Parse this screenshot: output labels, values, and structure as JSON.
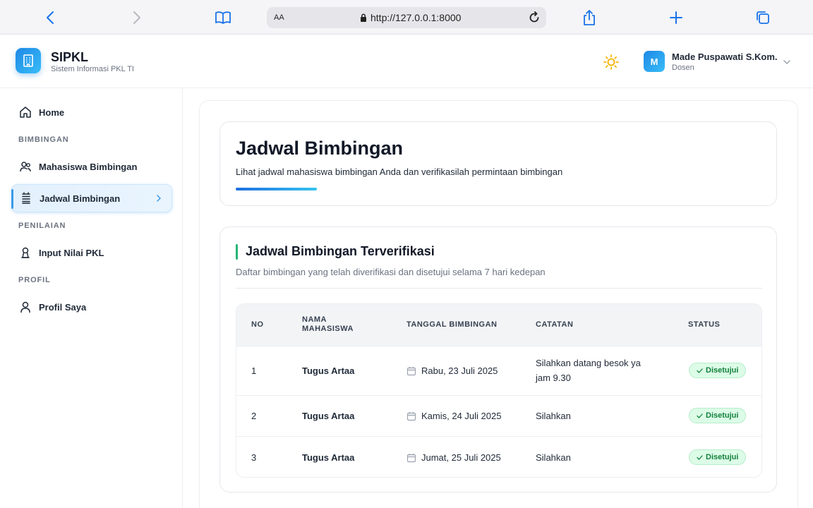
{
  "browser": {
    "text_size_label": "AA",
    "url": "http://127.0.0.1:8000"
  },
  "header": {
    "app_name": "SIPKL",
    "app_subtitle": "Sistem Informasi PKL TI",
    "user": {
      "initial": "M",
      "name": "Made Puspawati S.Kom.",
      "role": "Dosen"
    }
  },
  "sidebar": {
    "home": "Home",
    "section_bimbingan": "BIMBINGAN",
    "mahasiswa_bimbingan": "Mahasiswa Bimbingan",
    "jadwal_bimbingan": "Jadwal Bimbingan",
    "section_penilaian": "PENILAIAN",
    "input_nilai": "Input Nilai PKL",
    "section_profil": "PROFIL",
    "profil_saya": "Profil Saya"
  },
  "page": {
    "title": "Jadwal Bimbingan",
    "subtitle": "Lihat jadwal mahasiswa bimbingan Anda dan verifikasilah permintaan bimbingan"
  },
  "schedule": {
    "title": "Jadwal Bimbingan Terverifikasi",
    "subtitle": "Daftar bimbingan yang telah diverifikasi dan disetujui selama 7 hari kedepan",
    "columns": {
      "no": "NO",
      "nama_line1": "NAMA",
      "nama_line2": "MAHASISWA",
      "tanggal": "TANGGAL BIMBINGAN",
      "catatan": "CATATAN",
      "status": "STATUS"
    },
    "rows": [
      {
        "no": "1",
        "nama": "Tugus Artaa",
        "tanggal": "Rabu, 23 Juli 2025",
        "catatan_line1": "Silahkan datang besok ya",
        "catatan_line2": "jam 9.30",
        "status": "Disetujui"
      },
      {
        "no": "2",
        "nama": "Tugus Artaa",
        "tanggal": "Kamis, 24 Juli 2025",
        "catatan_line1": "Silahkan",
        "status": "Disetujui"
      },
      {
        "no": "3",
        "nama": "Tugus Artaa",
        "tanggal": "Jumat, 25 Juli 2025",
        "catatan_line1": "Silahkan",
        "status": "Disetujui"
      }
    ]
  },
  "colors": {
    "accent_blue": "#1e88e5",
    "accent_cyan": "#38bdf8",
    "status_green": "#15803d",
    "status_green_bg": "#dcfce7",
    "section_accent_green": "#22b573"
  },
  "icons": {
    "browser": [
      "chevron-left-icon",
      "chevron-right-icon",
      "book-icon",
      "lock-icon",
      "reload-icon",
      "share-icon",
      "plus-icon",
      "tabs-icon"
    ],
    "header": [
      "building-icon",
      "sun-icon",
      "chevron-down-icon"
    ],
    "sidebar": [
      "home-icon",
      "users-icon",
      "list-icon",
      "user-award-icon",
      "user-icon",
      "chevron-right-icon"
    ],
    "table": [
      "calendar-icon",
      "check-icon"
    ]
  }
}
